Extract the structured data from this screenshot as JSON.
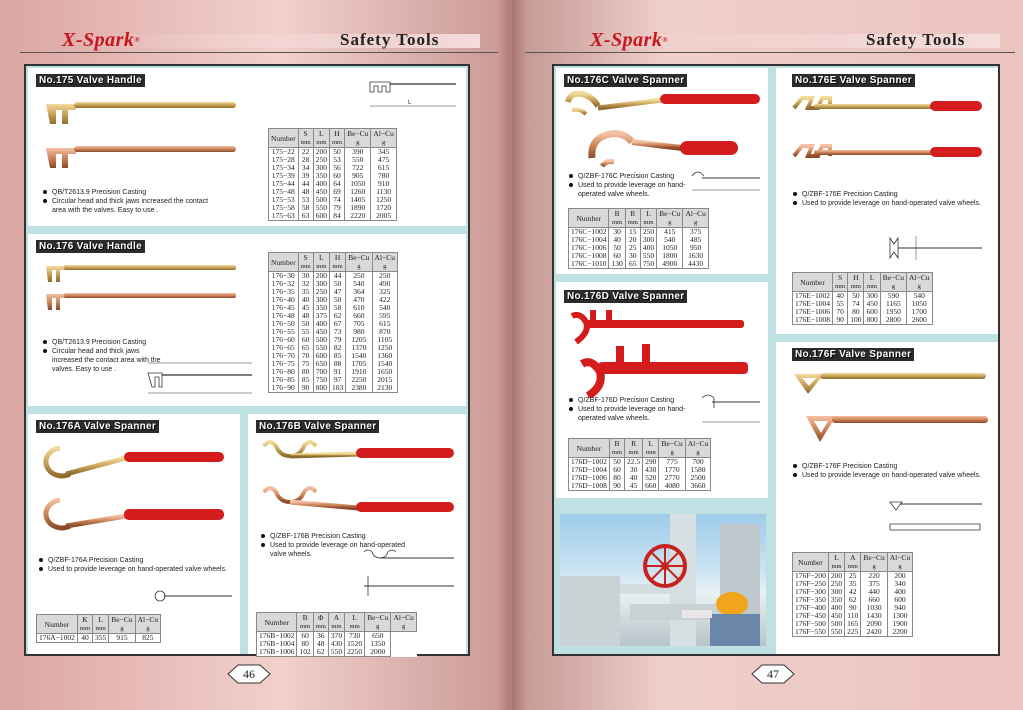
{
  "brand": "X-Spark",
  "brand_mark": "®",
  "header_title": "Safety Tools",
  "pages": {
    "left": "46",
    "right": "47"
  },
  "colors": {
    "brass": "#d2b56e",
    "copper": "#d08a64",
    "red": "#d41c1c",
    "frame_bg": "#bfe1e3",
    "brand_red": "#c8161d"
  },
  "sections": {
    "s175": {
      "title": "No.175 Valve Handle",
      "notes": [
        "QB/T2613.9  Precision Casting",
        "Circular head and thick jaws increased the contact area with the valves. Easy to use ."
      ],
      "headers": [
        [
          "Number",
          ""
        ],
        [
          "S",
          "mm"
        ],
        [
          "L",
          "mm"
        ],
        [
          "H",
          "mm"
        ],
        [
          "Be−Cu",
          "g"
        ],
        [
          "Al−Cu",
          "g"
        ]
      ],
      "rows": [
        [
          "175−22",
          "22",
          "200",
          "50",
          "390",
          "345"
        ],
        [
          "175−28",
          "28",
          "250",
          "53",
          "550",
          "475"
        ],
        [
          "175−34",
          "34",
          "300",
          "56",
          "722",
          "615"
        ],
        [
          "175−39",
          "39",
          "350",
          "60",
          "905",
          "780"
        ],
        [
          "175−44",
          "44",
          "400",
          "64",
          "1050",
          "910"
        ],
        [
          "175−48",
          "48",
          "450",
          "69",
          "1260",
          "1130"
        ],
        [
          "175−53",
          "53",
          "500",
          "74",
          "1405",
          "1250"
        ],
        [
          "175−58",
          "58",
          "550",
          "79",
          "1890",
          "1720"
        ],
        [
          "175−63",
          "63",
          "600",
          "84",
          "2220",
          "2005"
        ]
      ]
    },
    "s176": {
      "title": "No.176 Valve Handle",
      "notes": [
        "QB/T2613.9  Precision Casting",
        "Circular head and thick jaws increased the contact area with the valves. Easy to use ."
      ],
      "headers": [
        [
          "Number",
          ""
        ],
        [
          "S",
          "mm"
        ],
        [
          "L",
          "mm"
        ],
        [
          "H",
          "mm"
        ],
        [
          "Be−Cu",
          "g"
        ],
        [
          "Al−Cu",
          "g"
        ]
      ],
      "rows": [
        [
          "176−30",
          "30",
          "200",
          "44",
          "250",
          "250"
        ],
        [
          "176−32",
          "32",
          "300",
          "50",
          "540",
          "490"
        ],
        [
          "176−35",
          "35",
          "250",
          "47",
          "364",
          "325"
        ],
        [
          "176−40",
          "40",
          "300",
          "50",
          "470",
          "422"
        ],
        [
          "176−45",
          "45",
          "350",
          "58",
          "610",
          "540"
        ],
        [
          "176−48",
          "48",
          "375",
          "62",
          "660",
          "595"
        ],
        [
          "176−50",
          "50",
          "400",
          "67",
          "705",
          "615"
        ],
        [
          "176−55",
          "55",
          "450",
          "73",
          "980",
          "870"
        ],
        [
          "176−60",
          "60",
          "500",
          "79",
          "1205",
          "1105"
        ],
        [
          "176−65",
          "65",
          "550",
          "82",
          "1370",
          "1250"
        ],
        [
          "176−70",
          "70",
          "600",
          "85",
          "1540",
          "1360"
        ],
        [
          "176−75",
          "75",
          "650",
          "88",
          "1705",
          "1540"
        ],
        [
          "176−80",
          "80",
          "700",
          "91",
          "1910",
          "1650"
        ],
        [
          "176−85",
          "85",
          "750",
          "97",
          "2250",
          "2015"
        ],
        [
          "176−90",
          "90",
          "800",
          "103",
          "2380",
          "2130"
        ]
      ]
    },
    "s176a": {
      "title": "No.176A Valve Spanner",
      "notes": [
        "Q/ZBF-176A  Precision Casting",
        "Used to provide leverage on hand-operated valve wheels."
      ],
      "headers": [
        [
          "Number",
          ""
        ],
        [
          "K",
          "mm"
        ],
        [
          "L",
          "mm"
        ],
        [
          "Be−Cu",
          "g"
        ],
        [
          "Al−Cu",
          "g"
        ]
      ],
      "rows": [
        [
          "176A−1002",
          "40",
          "355",
          "915",
          "825"
        ]
      ]
    },
    "s176b": {
      "title": "No.176B Valve Spanner",
      "notes": [
        "Q/ZBF-176B  Precision Casting",
        "Used to provide leverage on hand-operated valve wheels."
      ],
      "headers": [
        [
          "Number",
          ""
        ],
        [
          "B",
          "mm"
        ],
        [
          "Φ",
          "mm"
        ],
        [
          "A",
          "mm"
        ],
        [
          "L",
          "mm"
        ],
        [
          "Be−Cu",
          "g"
        ],
        [
          "Al−Cu",
          "g"
        ]
      ],
      "rows": [
        [
          "176B−1002",
          "60",
          "36",
          "370",
          "730",
          "650"
        ],
        [
          "176B−1004",
          "80",
          "48",
          "430",
          "1520",
          "1350"
        ],
        [
          "176B−1006",
          "102",
          "62",
          "550",
          "2250",
          "2000"
        ]
      ]
    },
    "s176c": {
      "title": "No.176C Valve Spanner",
      "notes": [
        "Q/ZBF-176C  Precision Casting",
        "Used to provide leverage on hand-operated valve wheels."
      ],
      "headers": [
        [
          "Number",
          ""
        ],
        [
          "B",
          "mm"
        ],
        [
          "R",
          "mm"
        ],
        [
          "L",
          "mm"
        ],
        [
          "Be−Cu",
          "g"
        ],
        [
          "Al−Cu",
          "g"
        ]
      ],
      "rows": [
        [
          "176C−1002",
          "30",
          "15",
          "250",
          "415",
          "375"
        ],
        [
          "176C−1004",
          "40",
          "20",
          "300",
          "540",
          "485"
        ],
        [
          "176C−1006",
          "50",
          "25",
          "400",
          "1050",
          "950"
        ],
        [
          "176C−1008",
          "60",
          "30",
          "550",
          "1800",
          "1630"
        ],
        [
          "176C−1010",
          "130",
          "65",
          "750",
          "4900",
          "4430"
        ]
      ]
    },
    "s176d": {
      "title": "No.176D Valve Spanner",
      "notes": [
        "Q/ZBF-176D  Precision Casting",
        "Used to provide leverage on hand-operated valve wheels."
      ],
      "headers": [
        [
          "Number",
          ""
        ],
        [
          "B",
          "mm"
        ],
        [
          "R",
          "mm"
        ],
        [
          "L",
          "mm"
        ],
        [
          "Be−Cu",
          "g"
        ],
        [
          "Al−Cu",
          "g"
        ]
      ],
      "rows": [
        [
          "176D−1002",
          "50",
          "22.5",
          "290",
          "775",
          "700"
        ],
        [
          "176D−1004",
          "60",
          "30",
          "430",
          "1770",
          "1580"
        ],
        [
          "176D−1006",
          "80",
          "40",
          "520",
          "2770",
          "2500"
        ],
        [
          "176D−1008",
          "90",
          "45",
          "660",
          "4080",
          "3660"
        ]
      ]
    },
    "s176e": {
      "title": "No.176E Valve Spanner",
      "notes": [
        "Q/ZBF-176E  Precision Casting",
        "Used to provide leverage on hand-operated valve wheels."
      ],
      "headers": [
        [
          "Number",
          ""
        ],
        [
          "S",
          "mm"
        ],
        [
          "H",
          "mm"
        ],
        [
          "L",
          "mm"
        ],
        [
          "Be−Cu",
          "g"
        ],
        [
          "Al−Cu",
          "g"
        ]
      ],
      "rows": [
        [
          "176E−1002",
          "40",
          "50",
          "300",
          "590",
          "540"
        ],
        [
          "176E−1004",
          "55",
          "74",
          "450",
          "1165",
          "1050"
        ],
        [
          "176E−1006",
          "70",
          "80",
          "600",
          "1950",
          "1700"
        ],
        [
          "176E−1008",
          "90",
          "100",
          "800",
          "2800",
          "2600"
        ]
      ]
    },
    "s176f": {
      "title": "No.176F Valve Spanner",
      "notes": [
        "Q/ZBF-176F  Precision Casting",
        "Used to provide leverage on hand-operated valve wheels."
      ],
      "headers": [
        [
          "Number",
          ""
        ],
        [
          "L",
          "mm"
        ],
        [
          "A",
          "mm"
        ],
        [
          "Be−Cu",
          "g"
        ],
        [
          "Al−Cu",
          "g"
        ]
      ],
      "rows": [
        [
          "176F−200",
          "200",
          "25",
          "220",
          "200"
        ],
        [
          "176F−250",
          "250",
          "35",
          "375",
          "340"
        ],
        [
          "176F−300",
          "300",
          "42",
          "440",
          "400"
        ],
        [
          "176F−350",
          "350",
          "62",
          "660",
          "600"
        ],
        [
          "176F−400",
          "400",
          "90",
          "1030",
          "940"
        ],
        [
          "176F−450",
          "450",
          "110",
          "1430",
          "1300"
        ],
        [
          "176F−500",
          "500",
          "165",
          "2090",
          "1900"
        ],
        [
          "176F−550",
          "550",
          "225",
          "2420",
          "2200"
        ]
      ]
    }
  }
}
